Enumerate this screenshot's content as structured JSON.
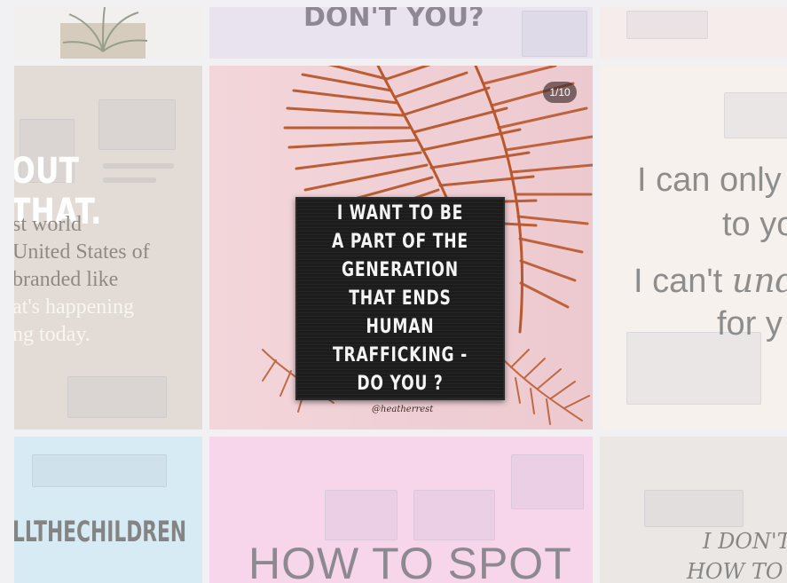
{
  "tiles": {
    "top_mid": {
      "headline": "DON'T YOU?"
    },
    "mid_left": {
      "headline": "OUT THAT.",
      "lines": [
        "st world",
        "United States of",
        "branded like",
        "at's happening",
        "ng today."
      ]
    },
    "post": {
      "counter": "1/10",
      "letterboard": [
        "I   WANT  TO  BE",
        "A  PART  OF  THE",
        "GENERATION",
        "THAT  ENDS",
        "HUMAN",
        "TRAFFICKING -",
        "DO YOU ?"
      ],
      "signature": "@heatherrest"
    },
    "mid_right": {
      "line1": "I can only",
      "line2": "to yo",
      "line3_prefix": "I can't ",
      "line3_script": "und",
      "line4": "for y"
    },
    "bot_left": {
      "hashtag": "LLTHECHILDREN"
    },
    "bot_mid": {
      "headline": "HOW TO SPOT"
    },
    "bot_right": {
      "line1": "I DON'T",
      "line2": "HOW TO"
    }
  },
  "colors": {
    "page_bg": "#f1f1f3",
    "letterboard": "#1c1c1c",
    "palm": "#b9582c",
    "pink_tile": "#f2b8df",
    "blue_tile": "#b9dcec"
  }
}
